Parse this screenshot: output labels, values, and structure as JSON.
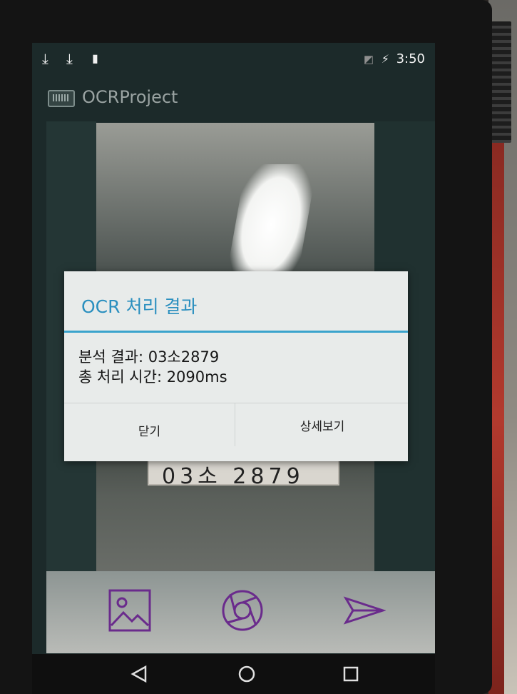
{
  "status_bar": {
    "icons": [
      "download-icon",
      "download-icon",
      "sd-card-icon",
      "no-sim-icon",
      "battery-charging-icon"
    ],
    "time": "3:50"
  },
  "app_bar": {
    "title": "OCRProject",
    "icon": "app-chip-icon"
  },
  "preview": {
    "plate_text": "03소 2879"
  },
  "dialog": {
    "title": "OCR 처리 결과",
    "result_line": "분석 결과: 03소2879",
    "time_line": "총 처리 시간: 2090ms",
    "close_label": "닫기",
    "details_label": "상세보기",
    "accent_color": "#2a8fbf"
  },
  "toolbar": {
    "buttons": [
      "gallery-icon",
      "camera-shutter-icon",
      "send-icon"
    ],
    "icon_color": "#6a2b8c"
  },
  "nav_bar": {
    "buttons": [
      "back-icon",
      "home-icon",
      "recents-icon"
    ]
  }
}
